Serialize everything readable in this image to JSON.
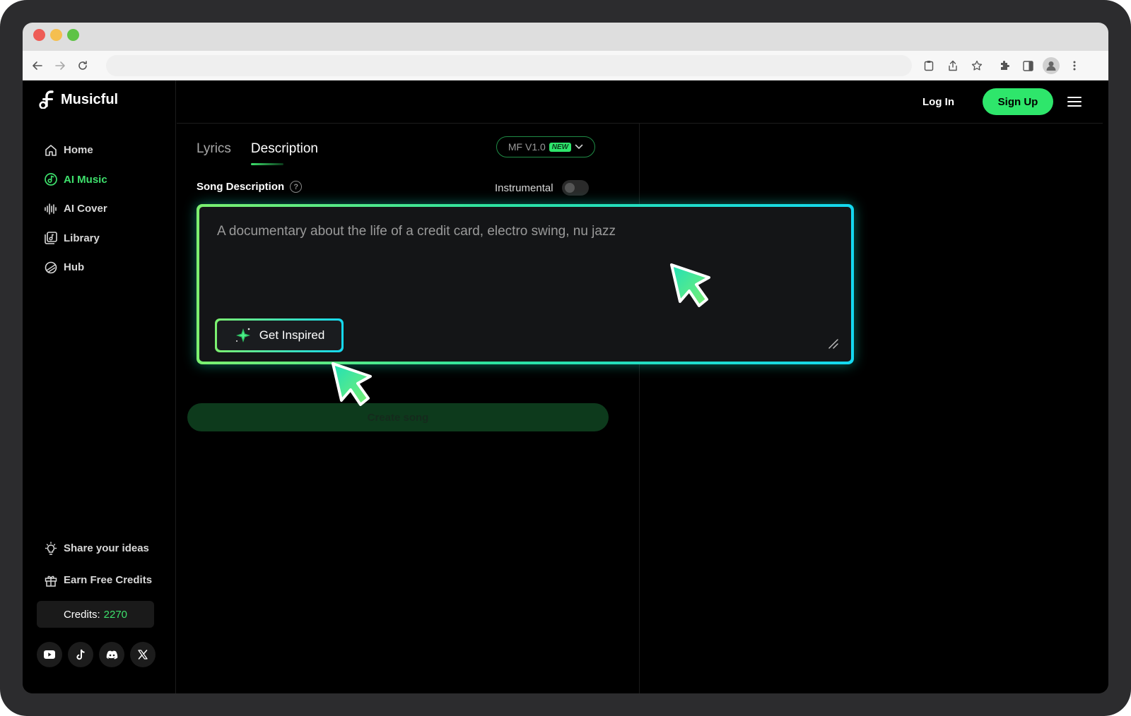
{
  "app": {
    "name": "Musicful"
  },
  "sidebar": {
    "items": [
      {
        "label": "Home",
        "icon": "home-icon",
        "active": false
      },
      {
        "label": "AI Music",
        "icon": "ai-music-icon",
        "active": true
      },
      {
        "label": "AI Cover",
        "icon": "waveform-icon",
        "active": false
      },
      {
        "label": "Library",
        "icon": "library-icon",
        "active": false
      },
      {
        "label": "Hub",
        "icon": "hub-icon",
        "active": false
      }
    ],
    "bottom_items": [
      {
        "label": "Share your ideas",
        "icon": "lightbulb-icon"
      },
      {
        "label": "Earn Free Credits",
        "icon": "gift-icon"
      }
    ],
    "credits_label": "Credits:",
    "credits_value": "2270",
    "socials": [
      "youtube-icon",
      "tiktok-icon",
      "discord-icon",
      "x-icon"
    ]
  },
  "header": {
    "login_label": "Log In",
    "signup_label": "Sign Up"
  },
  "main": {
    "tabs": [
      {
        "label": "Lyrics",
        "active": false
      },
      {
        "label": "Description",
        "active": true
      }
    ],
    "model": {
      "value": "MF V1.0",
      "badge": "NEW"
    },
    "song_description_label": "Song Description",
    "help_symbol": "?",
    "instrumental_label": "Instrumental",
    "instrumental_on": false,
    "textarea_placeholder": "A documentary about the life of a credit card, electro swing, nu jazz",
    "get_inspired_label": "Get Inspired",
    "create_song_label": "Create song"
  },
  "colors": {
    "accent": "#2ee66b",
    "highlight_gradient_start": "#7cf06f",
    "highlight_gradient_end": "#14d8f0",
    "background": "#000000"
  }
}
